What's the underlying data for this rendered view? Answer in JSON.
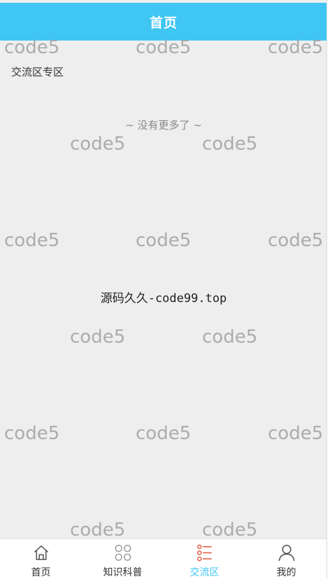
{
  "header": {
    "title": "首页"
  },
  "main": {
    "section_title": "交流区专区",
    "no_more_text": "~ 没有更多了 ~",
    "center_text": "源码久久-code99.top"
  },
  "watermark": {
    "text": "code5"
  },
  "tabbar": {
    "items": [
      {
        "label": "首页",
        "icon": "home-icon",
        "active": false
      },
      {
        "label": "知识科普",
        "icon": "grid-icon",
        "active": false
      },
      {
        "label": "交流区",
        "icon": "list-icon",
        "active": true
      },
      {
        "label": "我的",
        "icon": "user-icon",
        "active": false
      }
    ]
  },
  "colors": {
    "accent": "#3fc6f3",
    "icon_red": "#e35a43",
    "background": "#eeeeee"
  }
}
